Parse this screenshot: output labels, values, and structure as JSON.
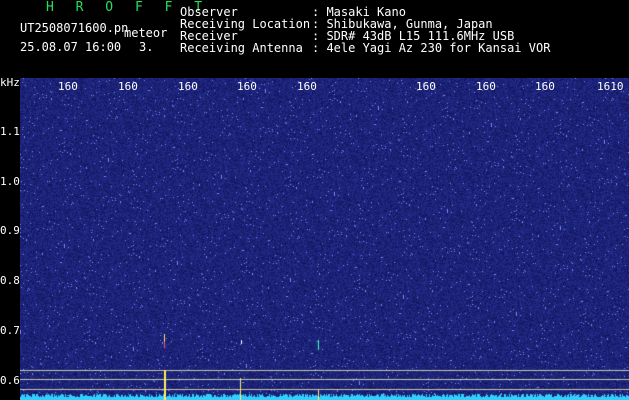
{
  "header": {
    "app_name": "H R O F F T",
    "filename": "UT2508071600.pn",
    "mode": "meteor",
    "datetime": "25.08.07 16:00",
    "count": "3.",
    "fields": [
      {
        "label": "Observer",
        "value": ": Masaki Kano"
      },
      {
        "label": "Receiving Location",
        "value": ": Shibukawa, Gunma, Japan"
      },
      {
        "label": "Receiver",
        "value": ": SDR# 43dB L15 111.6MHz USB"
      },
      {
        "label": "Receiving Antenna",
        "value": ": 4ele Yagi Az 230 for Kansai VOR"
      }
    ]
  },
  "axes": {
    "y_unit": "kHz",
    "y_ticks": [
      "1.1",
      "1.0",
      "0.9",
      "0.8",
      "0.7",
      "0.6"
    ],
    "x_ticks": [
      "160",
      "160",
      "160",
      "160",
      "160",
      "160",
      "160",
      "160",
      "1610"
    ]
  },
  "colors": {
    "background": "#000000",
    "spectrogram_base": "#1a1f7a",
    "grid_line": "#c8c8a0",
    "spectrum_trace": "#2fd0ff",
    "title_green": "#22e05a"
  }
}
